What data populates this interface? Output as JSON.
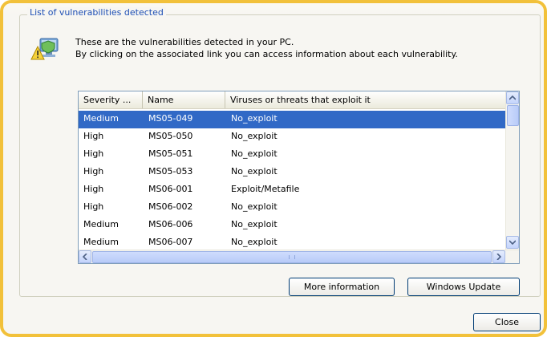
{
  "group": {
    "title": "List of vulnerabilities detected"
  },
  "intro": {
    "line1": "These are the vulnerabilities detected in your PC.",
    "line2": "By clicking on the associated link you can access information about each vulnerability.",
    "icon": "security-warning-icon"
  },
  "table": {
    "columns": [
      "Severity ...",
      "Name",
      "Viruses or threats that exploit it"
    ],
    "rows": [
      {
        "severity": "Medium",
        "name": "MS05-049",
        "threat": "No_exploit",
        "selected": true
      },
      {
        "severity": "High",
        "name": "MS05-050",
        "threat": "No_exploit"
      },
      {
        "severity": "High",
        "name": "MS05-051",
        "threat": "No_exploit"
      },
      {
        "severity": "High",
        "name": "MS05-053",
        "threat": "No_exploit"
      },
      {
        "severity": "High",
        "name": "MS06-001",
        "threat": "Exploit/Metafile"
      },
      {
        "severity": "High",
        "name": "MS06-002",
        "threat": "No_exploit"
      },
      {
        "severity": "Medium",
        "name": "MS06-006",
        "threat": "No_exploit"
      },
      {
        "severity": "Medium",
        "name": "MS06-007",
        "threat": "No_exploit"
      }
    ]
  },
  "buttons": {
    "more_info": "More information",
    "windows_update": "Windows Update",
    "close": "Close"
  },
  "colors": {
    "window_border": "#f2c13a",
    "group_title": "#1e4fb5",
    "selection": "#3169c6"
  }
}
